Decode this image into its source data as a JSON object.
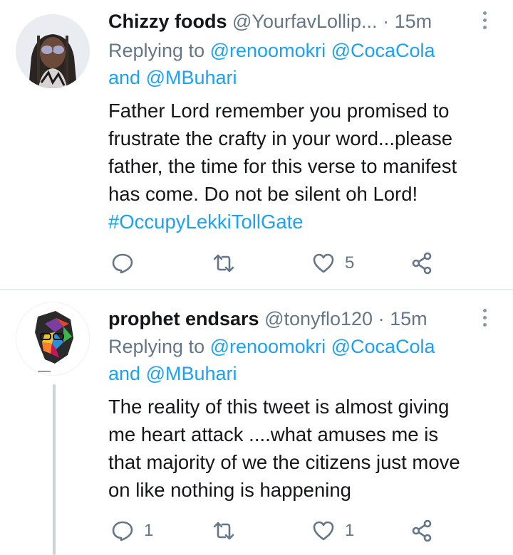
{
  "tweets": [
    {
      "display_name": "Chizzy foods",
      "handle": "@YourfavLollip...",
      "separator": "·",
      "time": "15m",
      "replying_prefix": "Replying to",
      "mention_1": "@renoomokri",
      "mention_2": "@CocaCola",
      "and_word": "and",
      "mention_3": "@MBuhari",
      "text_lines": [
        "Father Lord remember you promised to",
        "frustrate the crafty in your word...please",
        "father, the time for this verse to manifest",
        "has come. Do not be silent oh Lord!"
      ],
      "hashtag": "#OccupyLekkiTollGate",
      "reply_count": "",
      "retweet_count": "",
      "like_count": "5"
    },
    {
      "display_name": "prophet endsars",
      "handle": "@tonyflo120",
      "separator": "·",
      "time": "15m",
      "replying_prefix": "Replying to",
      "mention_1": "@renoomokri",
      "mention_2": "@CocaCola",
      "and_word": "and",
      "mention_3": "@MBuhari",
      "text_lines": [
        "The reality of this tweet is almost giving",
        "me heart attack ....what amuses me is",
        "that majority of we the citizens just move",
        "on like nothing is happening"
      ],
      "reply_count": "1",
      "retweet_count": "",
      "like_count": "1"
    }
  ],
  "colors": {
    "link": "#1da1f2",
    "secondary_text": "#657786",
    "icon": "#657786",
    "divider": "#e6ecf0"
  },
  "icons": {
    "reply": "speech-bubble",
    "retweet": "retweet-arrows",
    "like": "heart-outline",
    "share": "share-nodes",
    "more": "vertical-dots"
  }
}
